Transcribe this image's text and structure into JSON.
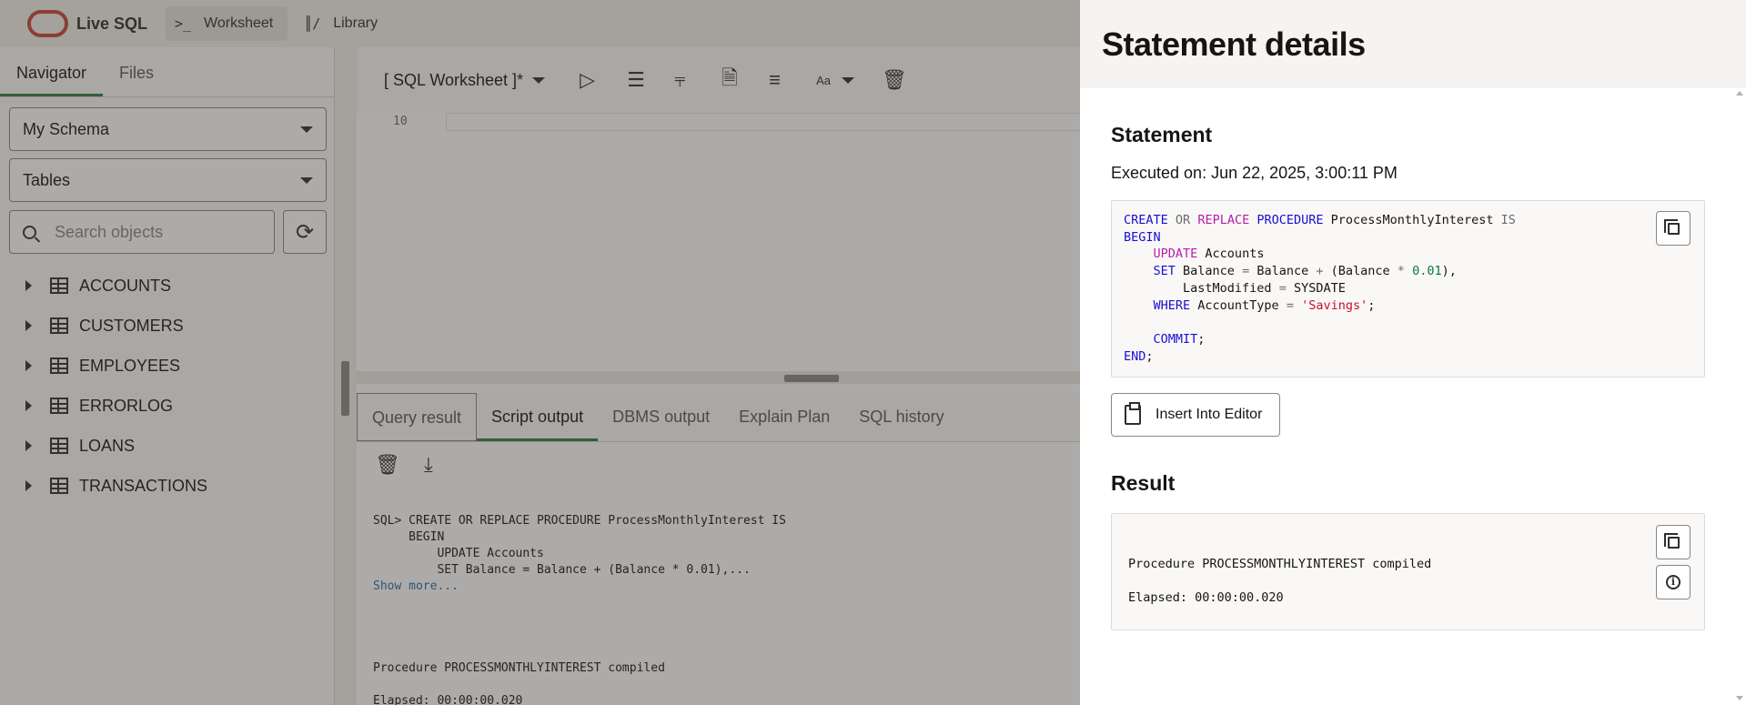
{
  "app": {
    "name": "Live SQL",
    "nav": [
      {
        "label": "Worksheet",
        "icon": "terminal-icon"
      },
      {
        "label": "Library",
        "icon": "library-icon"
      }
    ]
  },
  "navigator": {
    "tabs": [
      "Navigator",
      "Files"
    ],
    "schema_select": "My Schema",
    "object_type_select": "Tables",
    "search_placeholder": "Search objects",
    "tables": [
      "ACCOUNTS",
      "CUSTOMERS",
      "EMPLOYEES",
      "ERRORLOG",
      "LOANS",
      "TRANSACTIONS"
    ]
  },
  "worksheet": {
    "title": "[ SQL Worksheet ]*",
    "font_button": "Aa",
    "line_number": "10"
  },
  "results": {
    "tabs": [
      "Query result",
      "Script output",
      "DBMS output",
      "Explain Plan",
      "SQL history"
    ],
    "active_tab": "Script output",
    "output_lines": [
      "SQL> CREATE OR REPLACE PROCEDURE ProcessMonthlyInterest IS",
      "     BEGIN",
      "         UPDATE Accounts",
      "         SET Balance = Balance + (Balance * 0.01),..."
    ],
    "show_more": "Show more...",
    "compiled": "Procedure PROCESSMONTHLYINTEREST compiled",
    "elapsed": "Elapsed: 00:00:00.020"
  },
  "drawer": {
    "title": "Statement details",
    "statement_heading": "Statement",
    "executed_on": "Executed on: Jun 22, 2025, 3:00:11 PM",
    "insert_button": "Insert Into Editor",
    "result_heading": "Result",
    "result_compiled": "Procedure PROCESSMONTHLYINTEREST compiled",
    "result_elapsed": "Elapsed: 00:00:00.020"
  },
  "colors": {
    "brand": "#c74634",
    "active_tab": "#2f7a3b",
    "keyword": "#1a0fd0",
    "keyword_alt": "#b81ea8",
    "number": "#0a7a3a",
    "string": "#c8102e"
  }
}
